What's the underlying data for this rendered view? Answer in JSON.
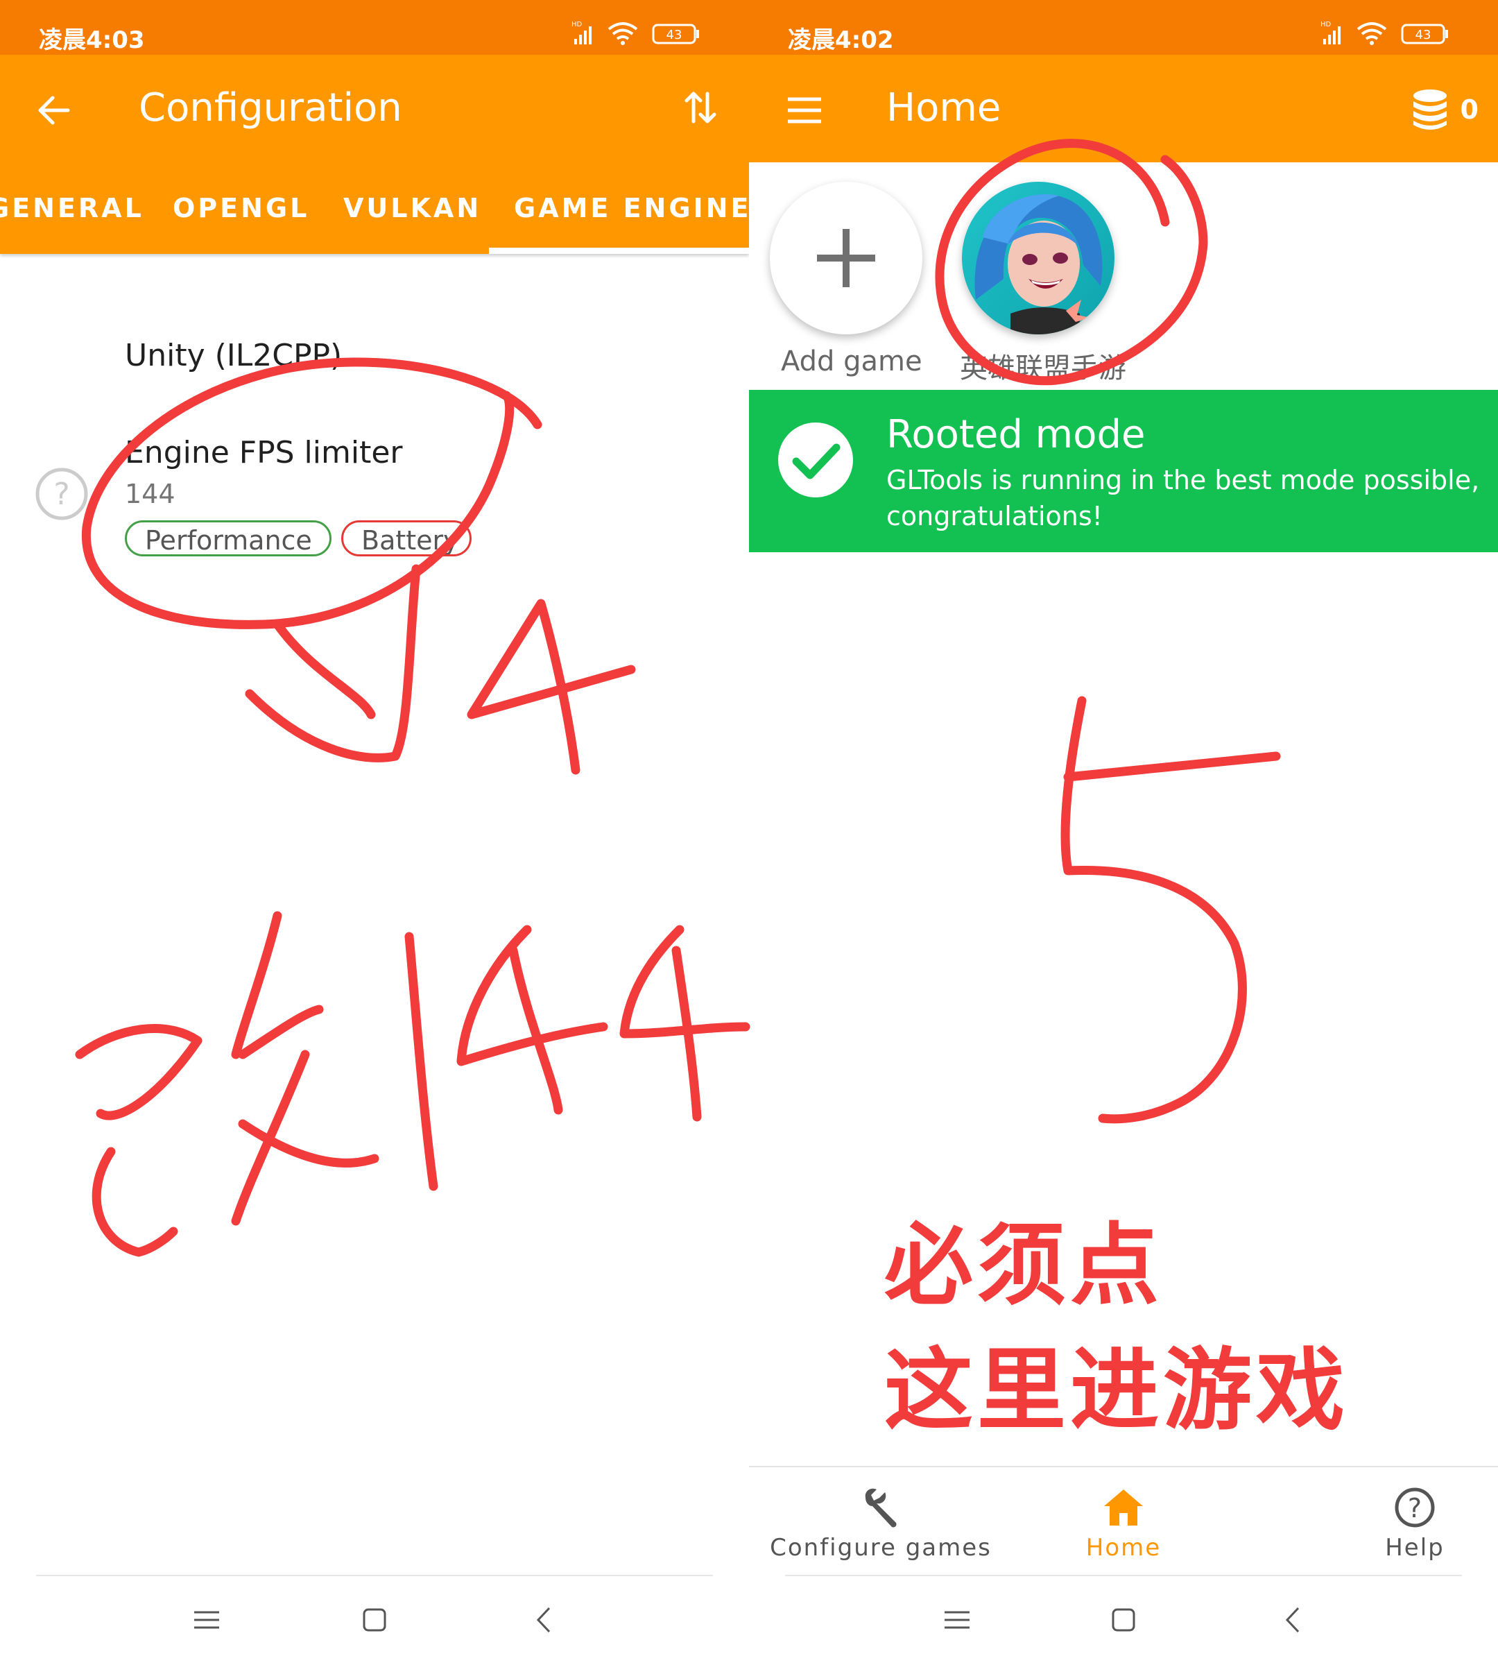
{
  "left": {
    "status": {
      "time": "凌晨4:03",
      "battery": "43"
    },
    "appbar": {
      "title": "Configuration"
    },
    "tabs": [
      "GENERAL",
      "OPENGL",
      "VULKAN",
      "GAME ENGINE"
    ],
    "engine_label": "Unity (IL2CPP)",
    "pref": {
      "title": "Engine FPS limiter",
      "value": "144",
      "chips": [
        "Performance",
        "Battery"
      ]
    }
  },
  "right": {
    "status": {
      "time": "凌晨4:02",
      "battery": "43"
    },
    "appbar": {
      "title": "Home",
      "coins": "0"
    },
    "games": [
      {
        "label": "Add game"
      },
      {
        "label": "英雄联盟手游"
      }
    ],
    "banner": {
      "title": "Rooted mode",
      "text": "GLTools is running in the best mode possible, congratulations!"
    },
    "bottom_nav": [
      {
        "label": "Configure games"
      },
      {
        "label": "Home"
      },
      {
        "label": "Help"
      }
    ]
  },
  "annotations": {
    "step4_number": "4",
    "step4_note": "改144",
    "step5_number": "5",
    "step5_note_line1": "必须点",
    "step5_note_line2": "这里进游戏"
  },
  "colors": {
    "status_bar": "#f57c00",
    "app_bar": "#ff9800",
    "banner_green": "#13c152",
    "active_nav": "#ff9800",
    "annotation_red": "#f23b3b"
  },
  "icons": {
    "back": "arrow-left-icon",
    "sort": "swap-vertical-icon",
    "menu": "hamburger-menu-icon",
    "coins": "coins-stack-icon",
    "check": "check-circle-icon",
    "wrench": "wrench-icon",
    "home": "home-icon",
    "help": "help-circle-icon"
  }
}
